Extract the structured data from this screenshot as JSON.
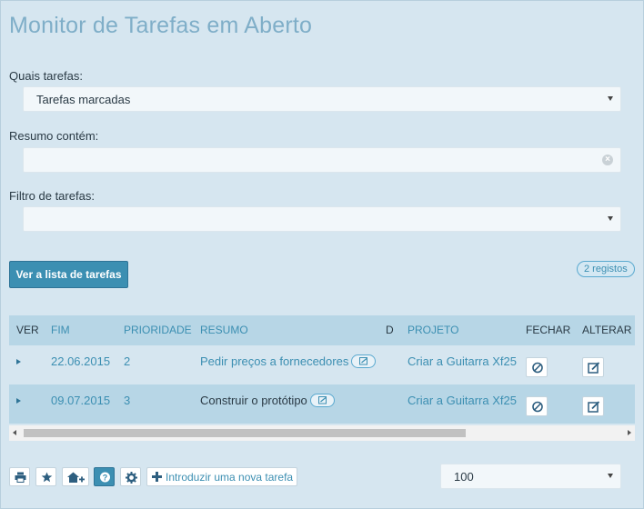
{
  "page": {
    "title": "Monitor de Tarefas em Aberto"
  },
  "filters": {
    "which_label": "Quais tarefas:",
    "which_value": "Tarefas marcadas",
    "summary_label": "Resumo contém:",
    "summary_value": "",
    "filter_label": "Filtro de tarefas:",
    "filter_value": ""
  },
  "actions": {
    "view_list_label": "Ver a lista de tarefas",
    "records_badge": "2 registos"
  },
  "table": {
    "columns": {
      "ver": "VER",
      "fim": "FIM",
      "prioridade": "PRIORIDADE",
      "resumo": "RESUMO",
      "d": "D",
      "projeto": "PROJETO",
      "fechar": "FECHAR",
      "alterar": "ALTERAR"
    },
    "rows": [
      {
        "fim": "22.06.2015",
        "prioridade": "2",
        "resumo": "Pedir preços a fornecedores",
        "projeto": "Criar a Guitarra Xf25"
      },
      {
        "fim": "09.07.2015",
        "prioridade": "3",
        "resumo": "Construir o protótipo",
        "projeto": "Criar a Guitarra Xf25"
      }
    ],
    "scroll_fraction": 0.0
  },
  "toolbar": {
    "icons": [
      "print-icon",
      "star-icon",
      "home-plus-icon",
      "help-icon",
      "gear-icon",
      "plus-icon"
    ],
    "new_task_label": "Introduzir uma nova tarefa",
    "page_size_value": "100"
  },
  "colors": {
    "background": "#d6e6f0",
    "accent": "#3c8fb2",
    "title": "#7faec8",
    "header_row": "#b7d6e6"
  }
}
